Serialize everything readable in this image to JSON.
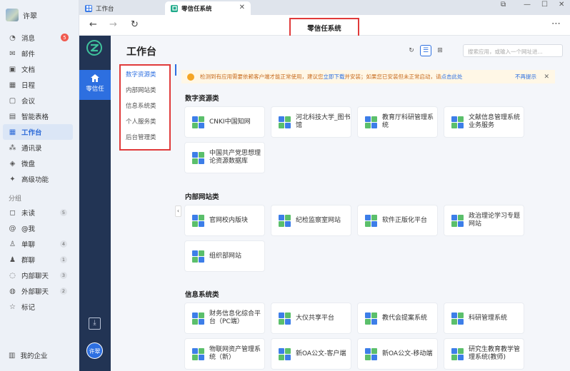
{
  "sidebar": {
    "user_name": "许翠",
    "items": [
      {
        "label": "消息",
        "icon": "chat-icon",
        "badge": "5"
      },
      {
        "label": "邮件",
        "icon": "mail-icon"
      },
      {
        "label": "文档",
        "icon": "doc-icon"
      },
      {
        "label": "日程",
        "icon": "calendar-icon"
      },
      {
        "label": "会议",
        "icon": "meeting-icon"
      },
      {
        "label": "智能表格",
        "icon": "table-icon"
      },
      {
        "label": "工作台",
        "icon": "workbench-icon",
        "active": true
      },
      {
        "label": "通讯录",
        "icon": "contacts-icon"
      },
      {
        "label": "微盘",
        "icon": "drive-icon"
      },
      {
        "label": "高级功能",
        "icon": "sparkle-icon"
      }
    ],
    "group_title": "分组",
    "groups": [
      {
        "label": "未读",
        "icon": "unread-icon",
        "count": "5"
      },
      {
        "label": "@我",
        "icon": "at-icon"
      },
      {
        "label": "单聊",
        "icon": "person-icon",
        "count": "4"
      },
      {
        "label": "群聊",
        "icon": "group-icon",
        "count": "1"
      },
      {
        "label": "内部聊天",
        "icon": "bubble-icon",
        "count": "3"
      },
      {
        "label": "外部聊天",
        "icon": "external-icon",
        "count": "2"
      },
      {
        "label": "标记",
        "icon": "star-icon"
      }
    ],
    "company": "我的企业"
  },
  "browser": {
    "tabs": [
      {
        "label": "工作台"
      },
      {
        "label": "零信任系统",
        "active": true
      }
    ],
    "page_title": "零信任系统"
  },
  "appnav": {
    "active_label": "零信任",
    "avatar_text": "许翠"
  },
  "page": {
    "title": "工作台",
    "search_placeholder": "搜索应用，或输入一个网址进...",
    "categories": [
      "数字资源类",
      "内部网站类",
      "信息系统类",
      "个人服务类",
      "后台管理类"
    ],
    "notice": {
      "text_before": "检测到有应用需要依赖客户端才能正常使用，建议您",
      "link_download": "立即下载",
      "text_middle": "并安装；如果您已安装但未正常启动，请",
      "link_wake": "点击此处",
      "dismiss": "不再提示"
    },
    "sections": [
      {
        "title": "数字资源类",
        "apps": [
          "CNKI中国知网",
          "河北科技大学_图书馆",
          "教育厅科研管理系统",
          "文献信息管理系统业务服务",
          "中国共产党思想理论资源数据库"
        ]
      },
      {
        "title": "内部网站类",
        "apps": [
          "官网校内版块",
          "纪检监察室网站",
          "软件正版化平台",
          "政治理论学习专题网站",
          "组织部网站"
        ]
      },
      {
        "title": "信息系统类",
        "apps": [
          "财务信息化综合平台（PC端）",
          "大仪共享平台",
          "教代会提案系统",
          "科研管理系统",
          "物联网资产管理系统（新）",
          "新OA公文-客户端",
          "新OA公文-移动端",
          "研究生教育教学管理系统(教师)"
        ]
      }
    ]
  },
  "colors": {
    "accent": "#2d6fe0",
    "appnav_bg": "#223454",
    "highlight_box": "#e03a3a",
    "notice_bg": "#fff7e6"
  }
}
